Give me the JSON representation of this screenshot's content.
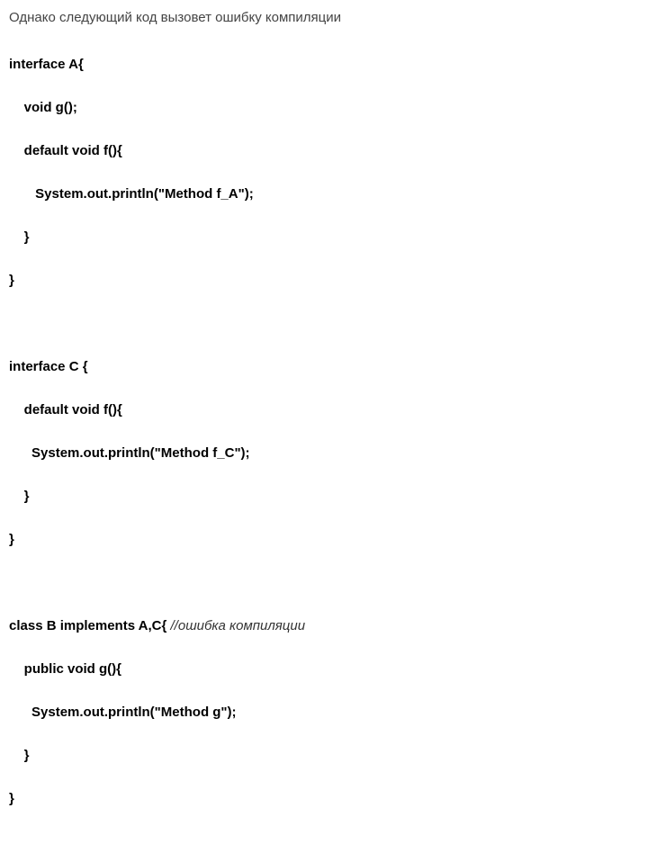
{
  "intro": "Однако следующий код вызовет ошибку компиляции",
  "code": {
    "l01": "interface A{",
    "l02": "    void g();",
    "l03": "    default void f(){",
    "l04": "       System.out.println(\"Method f_A\");",
    "l05": "    }",
    "l06": "}",
    "l07": "interface C {",
    "l08": "    default void f(){",
    "l09": "      System.out.println(\"Method f_C\");",
    "l10": "    }",
    "l11": "}",
    "l12a": "class B implements A,C{ ",
    "l12b": "//ошибка компиляции",
    "l13": "    public void g(){",
    "l14": "      System.out.println(\"Method g\");",
    "l15": "    }",
    "l16": "}"
  }
}
